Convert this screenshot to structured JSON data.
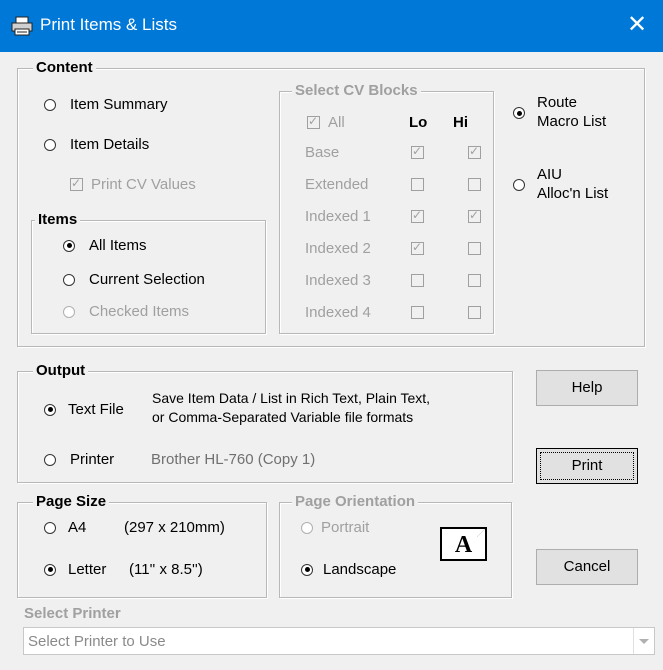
{
  "window": {
    "title": "Print Items & Lists",
    "close": "✕"
  },
  "content": {
    "legend": "Content",
    "item_summary": "Item Summary",
    "item_details": "Item Details",
    "print_cv_values": "Print CV Values",
    "items": {
      "legend": "Items",
      "all_items": "All Items",
      "current_selection": "Current Selection",
      "checked_items": "Checked Items"
    },
    "cv_blocks": {
      "legend": "Select CV Blocks",
      "all": "All",
      "lo": "Lo",
      "hi": "Hi",
      "rows": [
        {
          "label": "Base",
          "lo": true,
          "hi": true
        },
        {
          "label": "Extended",
          "lo": false,
          "hi": false
        },
        {
          "label": "Indexed 1",
          "lo": true,
          "hi": true
        },
        {
          "label": "Indexed 2",
          "lo": true,
          "hi": false
        },
        {
          "label": "Indexed 3",
          "lo": false,
          "hi": false
        },
        {
          "label": "Indexed 4",
          "lo": false,
          "hi": false
        }
      ]
    },
    "route_macro_1": "Route",
    "route_macro_2": "Macro List",
    "aiu_1": "AIU",
    "aiu_2": "Alloc'n List"
  },
  "output": {
    "legend": "Output",
    "text_file": "Text File",
    "text_file_desc_1": "Save Item Data / List in Rich Text, Plain Text,",
    "text_file_desc_2": "or Comma-Separated Variable file formats",
    "printer": "Printer",
    "printer_name": "Brother HL-760 (Copy 1)"
  },
  "page_size": {
    "legend": "Page Size",
    "a4": "A4",
    "a4_dims": "(297 x 210mm)",
    "letter": "Letter",
    "letter_dims": "(11'' x 8.5'')"
  },
  "orientation": {
    "legend": "Page Orientation",
    "portrait": "Portrait",
    "landscape": "Landscape",
    "glyph": "A"
  },
  "buttons": {
    "help": "Help",
    "print": "Print",
    "cancel": "Cancel"
  },
  "select_printer": {
    "label": "Select Printer",
    "placeholder": "Select Printer to Use"
  },
  "colors": {
    "titlebar": "#0078d7",
    "disabled_text": "#a0a0a0"
  }
}
